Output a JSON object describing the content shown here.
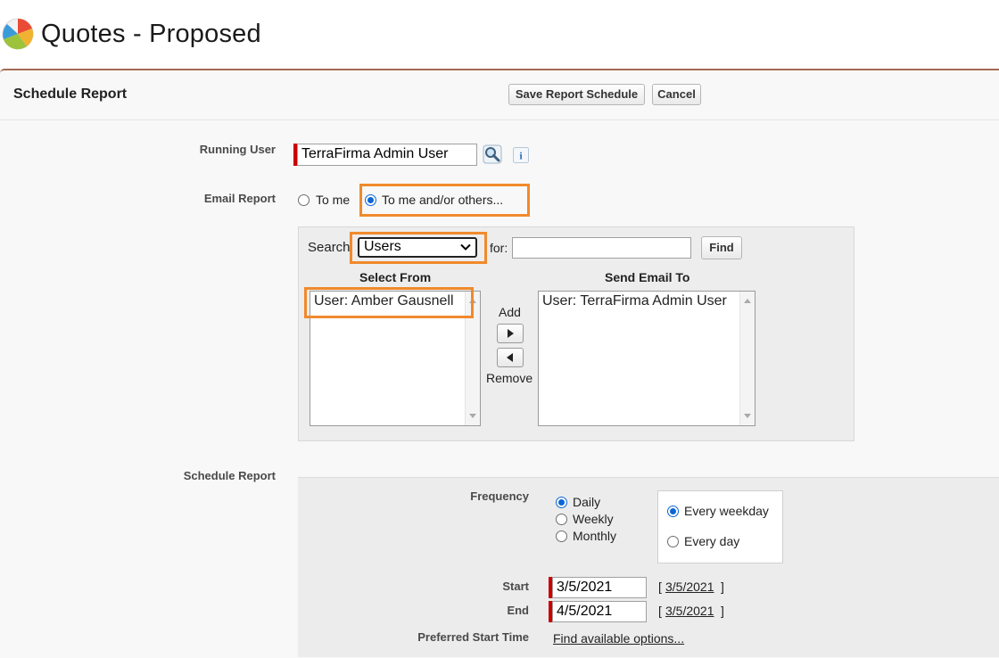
{
  "page": {
    "title": "Quotes - Proposed"
  },
  "header": {
    "title": "Schedule Report",
    "save_label": "Save Report Schedule",
    "cancel_label": "Cancel"
  },
  "running_user": {
    "label": "Running User",
    "value": "TerraFirma Admin User"
  },
  "email_report": {
    "label": "Email Report",
    "option_me": "To me",
    "option_others": "To me and/or others...",
    "selected": "others"
  },
  "search": {
    "label": "Search",
    "selected_scope": "Users",
    "for_label": "for:",
    "query": "",
    "find_label": "Find"
  },
  "select_from": {
    "heading": "Select From",
    "items": [
      "User: Amber Gausnell"
    ]
  },
  "transfer": {
    "add_label": "Add",
    "remove_label": "Remove"
  },
  "send_email_to": {
    "heading": "Send Email To",
    "items": [
      "User: TerraFirma Admin User"
    ]
  },
  "schedule": {
    "label": "Schedule Report",
    "frequency_label": "Frequency",
    "frequency_options": [
      "Daily",
      "Weekly",
      "Monthly"
    ],
    "frequency_selected": "Daily",
    "day_options": [
      "Every weekday",
      "Every day"
    ],
    "day_selected": "Every weekday",
    "start_label": "Start",
    "start_value": "3/5/2021",
    "start_today": "3/5/2021",
    "end_label": "End",
    "end_value": "4/5/2021",
    "end_today": "3/5/2021",
    "preferred_label": "Preferred Start Time",
    "find_options_link": "Find available options..."
  },
  "colors": {
    "highlight": "#f08a2c",
    "required": "#cc0000",
    "radio_selected": "#0b66d6",
    "panel_border": "#a46a55"
  },
  "icons": {
    "logo": "report-chart-icon",
    "lookup": "magnifier-lookup-icon",
    "info": "info-icon"
  }
}
